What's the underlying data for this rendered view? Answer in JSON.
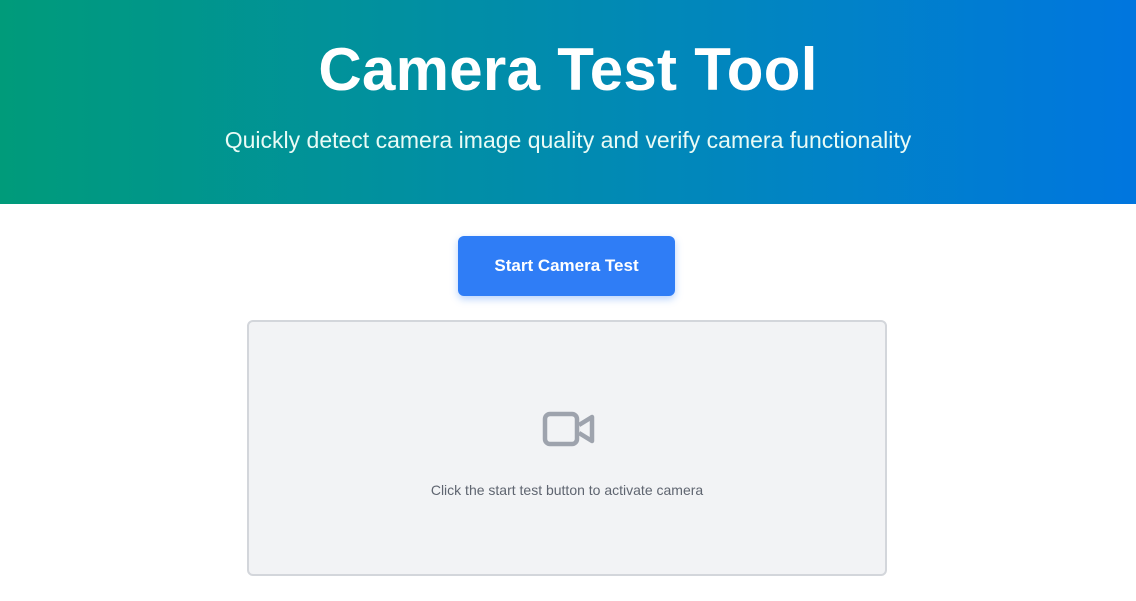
{
  "header": {
    "title": "Camera Test Tool",
    "subtitle": "Quickly detect camera image quality and verify camera functionality"
  },
  "controls": {
    "start_label": "Start Camera Test"
  },
  "preview": {
    "icon": "video-camera-icon",
    "hint": "Click the start test button to activate camera"
  },
  "colors": {
    "gradient_start": "#009b7a",
    "gradient_end": "#0076df",
    "button": "#2f7df6",
    "preview_bg": "#f2f3f5"
  }
}
